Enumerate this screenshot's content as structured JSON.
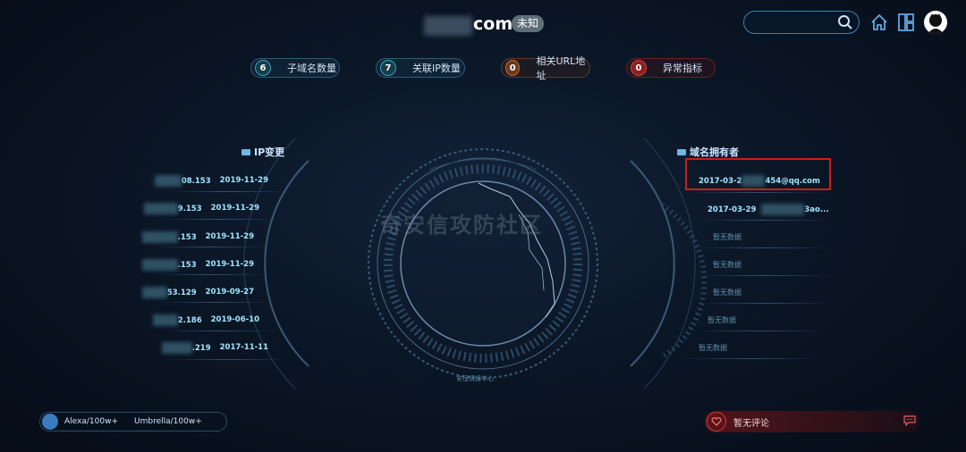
{
  "header": {
    "domain_suffix": "com",
    "status": "未知",
    "search_placeholder": ""
  },
  "stats": [
    {
      "value": "6",
      "label": "子域名数量"
    },
    {
      "value": "7",
      "label": "关联IP数量"
    },
    {
      "value": "0",
      "label": "相关URL地址"
    },
    {
      "value": "0",
      "label": "异常指标"
    }
  ],
  "ip_section": {
    "title": "IP变更",
    "rows": [
      {
        "ip": "08.153",
        "date": "2019-11-29"
      },
      {
        "ip": "9.153",
        "date": "2019-11-29"
      },
      {
        "ip": ".153",
        "date": "2019-11-29"
      },
      {
        "ip": ".153",
        "date": "2019-11-29"
      },
      {
        "ip": "53.129",
        "date": "2019-09-27"
      },
      {
        "ip": "2.186",
        "date": "2019-06-10"
      },
      {
        "ip": ".219",
        "date": "2017-11-11"
      }
    ]
  },
  "owner_section": {
    "title": "域名拥有者",
    "rows": [
      {
        "date": "2017-03-2",
        "email": "454@qq.com"
      },
      {
        "date": "2017-03-29",
        "email": "3ao..."
      }
    ],
    "no_data": [
      "暂无数据",
      "暂无数据",
      "暂无数据",
      "暂无数据",
      "暂无数据"
    ]
  },
  "watermark": "奇安信攻防社区",
  "globe_caption": "安恒情报中心",
  "ranking": {
    "alexa": "Alexa/100w+",
    "umbrella": "Umbrella/100w+"
  },
  "comment": {
    "label": "暂无评论"
  },
  "colors": {
    "accent": "#3f7fb2",
    "alert": "#d01a1a"
  }
}
